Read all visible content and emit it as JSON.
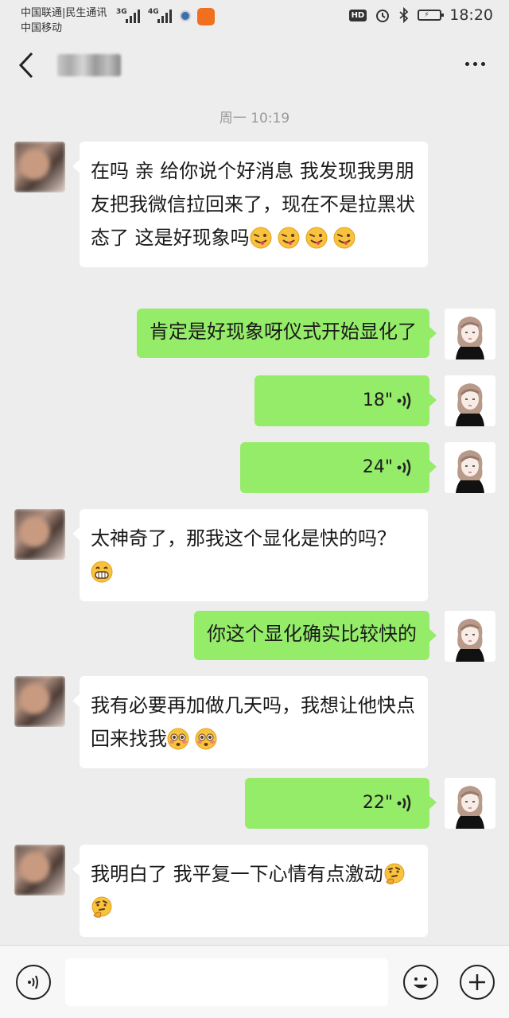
{
  "status_bar": {
    "carrier_1": "中国联通|民生通讯",
    "carrier_2": "中国移动",
    "network_1": "3G",
    "network_2": "4G",
    "hd": "HD",
    "time": "18:20"
  },
  "chat": {
    "timestamp": "周一 10:19",
    "messages": [
      {
        "side": "left",
        "type": "text",
        "text": "在吗 亲 给你说个好消息 我发现我男朋友把我微信拉回来了，现在不是拉黑状态了 这是好现象吗",
        "emoji": "tongue-wink-emoji",
        "emoji_count": 4
      },
      {
        "side": "right",
        "type": "text",
        "text": "肯定是好现象呀仪式开始显化了"
      },
      {
        "side": "right",
        "type": "voice",
        "duration": "18\""
      },
      {
        "side": "right",
        "type": "voice",
        "duration": "24\""
      },
      {
        "side": "left",
        "type": "text",
        "text": "太神奇了，那我这个显化是快的吗？",
        "emoji": "grin-emoji",
        "emoji_count": 1
      },
      {
        "side": "right",
        "type": "text",
        "text": "你这个显化确实比较快的"
      },
      {
        "side": "left",
        "type": "text",
        "text": "我有必要再加做几天吗，我想让他快点回来找我",
        "emoji": "flushed-emoji",
        "emoji_count": 2
      },
      {
        "side": "right",
        "type": "voice",
        "duration": "22\""
      },
      {
        "side": "left",
        "type": "text",
        "text": "我明白了  我平复一下心情有点激动",
        "emoji": "thinking-emoji",
        "emoji_count": 2
      }
    ]
  },
  "colors": {
    "background": "#ededed",
    "outgoing_bubble": "#95ec69",
    "incoming_bubble": "#ffffff"
  },
  "icons": [
    "back-arrow-icon",
    "more-icon",
    "voice-input-icon",
    "emoji-icon",
    "plus-icon",
    "voice-wave-icon"
  ]
}
